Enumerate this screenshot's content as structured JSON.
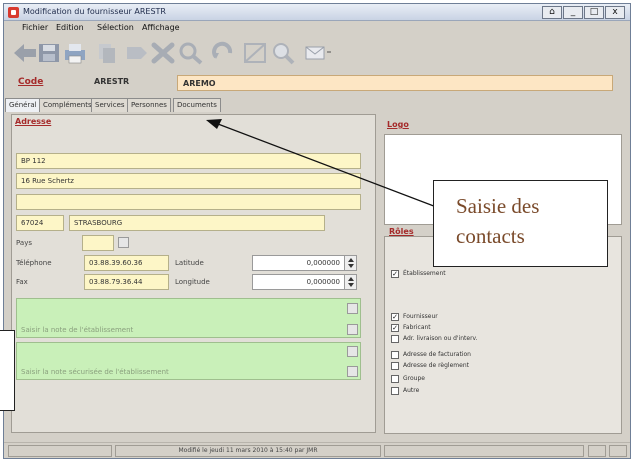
{
  "window": {
    "title": "Modification du fournisseur ARESTR",
    "controls": [
      "⌂",
      "_",
      "□",
      "x"
    ]
  },
  "menu": [
    "Fichier",
    "Edition",
    "Sélection",
    "Affichage"
  ],
  "toolbar": {
    "icons": [
      "back-arrow-icon",
      "save-icon",
      "print-icon",
      "copy-icon",
      "edit-icon",
      "delete-icon",
      "search-icon",
      "refresh-icon",
      "grid-icon",
      "zoom-icon",
      "email-icon"
    ]
  },
  "record": {
    "code_label": "Code",
    "code": "ARESTR",
    "name": "AREMO"
  },
  "tabs": [
    "Général",
    "Compléments",
    "Services",
    "Personnes",
    "Documents"
  ],
  "address": {
    "title": "Adresse",
    "line1": "BP 112",
    "line2": "16 Rue Schertz",
    "line3": "",
    "postal_code": "67024",
    "city": "STRASBOURG",
    "country_label": "Pays",
    "phone_label": "Téléphone",
    "phone": "03.88.39.60.36",
    "fax_label": "Fax",
    "fax": "03.88.79.36.44",
    "latitude_label": "Latitude",
    "latitude": "0,000000",
    "longitude_label": "Longitude",
    "longitude": "0,000000",
    "note_placeholder": "Saisir la note de l'établissement",
    "secure_note_placeholder": "Saisir la note sécurisée de l'établissement"
  },
  "logo": {
    "title": "Logo"
  },
  "roles": {
    "title": "Rôles",
    "items": [
      {
        "label": "Établissement",
        "checked": true
      },
      {
        "label": "Fournisseur",
        "checked": true
      },
      {
        "label": "Fabricant",
        "checked": true
      },
      {
        "label": "Adr. livraison ou d'interv.",
        "checked": false
      },
      {
        "label": "Adresse de facturation",
        "checked": false
      },
      {
        "label": "Adresse de règlement",
        "checked": false
      },
      {
        "label": "Groupe",
        "checked": false
      },
      {
        "label": "Autre",
        "checked": false
      }
    ]
  },
  "status": {
    "text": "Modifié le jeudi 11 mars 2010 à 15:40 par JMR"
  },
  "annotation": {
    "text": "Saisie des contacts"
  },
  "colors": {
    "section_title": "#a52a2a",
    "field_yellow": "#fdf6c7",
    "note_green": "#c9f0b9",
    "name_field": "#fde6c4"
  }
}
